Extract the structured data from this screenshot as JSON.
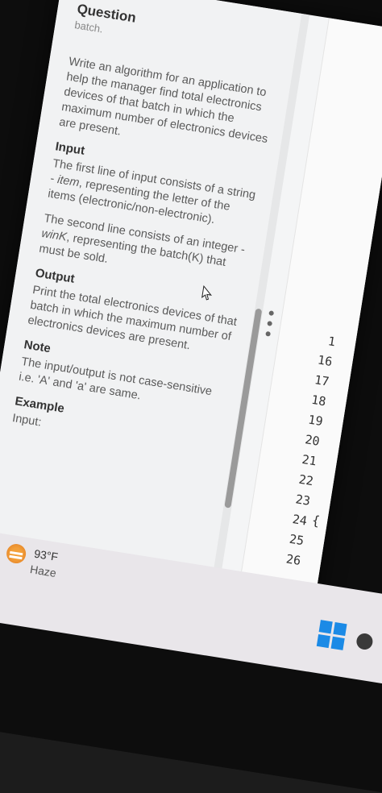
{
  "question": {
    "title": "Question",
    "subtitle": "batch.",
    "description": "Write an algorithm for an application to help the manager find total electronics devices of that batch in which the maximum number of electronics devices are present.",
    "input_heading": "Input",
    "input_line1_pre": "The first line of input consists of a string - ",
    "input_line1_var": "item",
    "input_line1_post": ", representing the letter of the items (electronic/non-electronic).",
    "input_line2_pre": "The second line consists of an integer - ",
    "input_line2_var": "winK",
    "input_line2_post": ", representing the batch(K) that must be sold.",
    "output_heading": "Output",
    "output_text": "Print the total electronics devices of that batch in which the maximum number of electronics devices are present.",
    "note_heading": "Note",
    "note_text": "The input/output is not case-sensitive i.e. 'A' and 'a' are same.",
    "example_heading": "Example",
    "example_input_label": "Input:"
  },
  "editor": {
    "line_numbers": [
      "1",
      "16",
      "17",
      "18",
      "19",
      "20",
      "21",
      "22",
      "23",
      "24",
      "25",
      "26"
    ],
    "brace": "{"
  },
  "taskbar": {
    "temperature": "93°F",
    "condition": "Haze"
  }
}
